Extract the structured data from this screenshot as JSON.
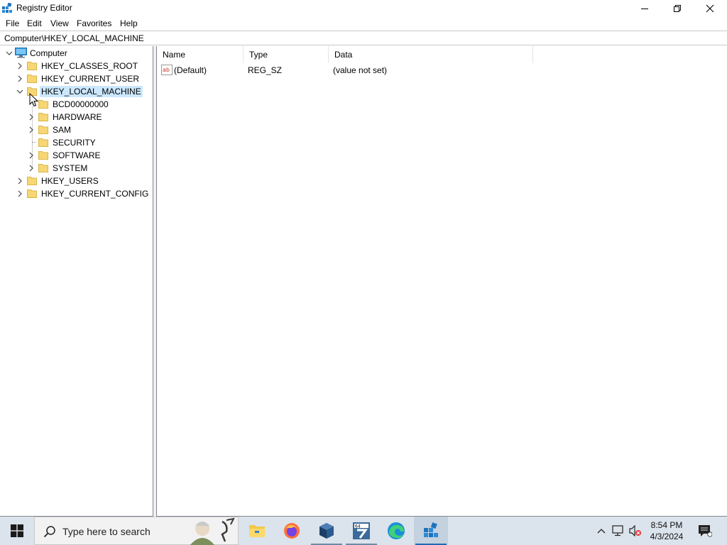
{
  "window": {
    "title": "Registry Editor",
    "menu": [
      "File",
      "Edit",
      "View",
      "Favorites",
      "Help"
    ],
    "address": "Computer\\HKEY_LOCAL_MACHINE"
  },
  "tree": {
    "root": "Computer",
    "hives": {
      "classes_root": "HKEY_CLASSES_ROOT",
      "current_user": "HKEY_CURRENT_USER",
      "local_machine": "HKEY_LOCAL_MACHINE",
      "users": "HKEY_USERS",
      "current_config": "HKEY_CURRENT_CONFIG"
    },
    "local_machine_children": [
      "BCD00000000",
      "HARDWARE",
      "SAM",
      "SECURITY",
      "SOFTWARE",
      "SYSTEM"
    ],
    "selected": "HKEY_LOCAL_MACHINE"
  },
  "values": {
    "headers": [
      "Name",
      "Type",
      "Data"
    ],
    "rows": [
      {
        "name": "(Default)",
        "type": "REG_SZ",
        "data": "(value not set)"
      }
    ]
  },
  "taskbar": {
    "search_placeholder": "Type here to search",
    "time": "8:54 PM",
    "date": "4/3/2024"
  },
  "colors": {
    "selection": "#cce8ff",
    "folder": "#f7d774",
    "taskbar": "#dbe3ec"
  }
}
